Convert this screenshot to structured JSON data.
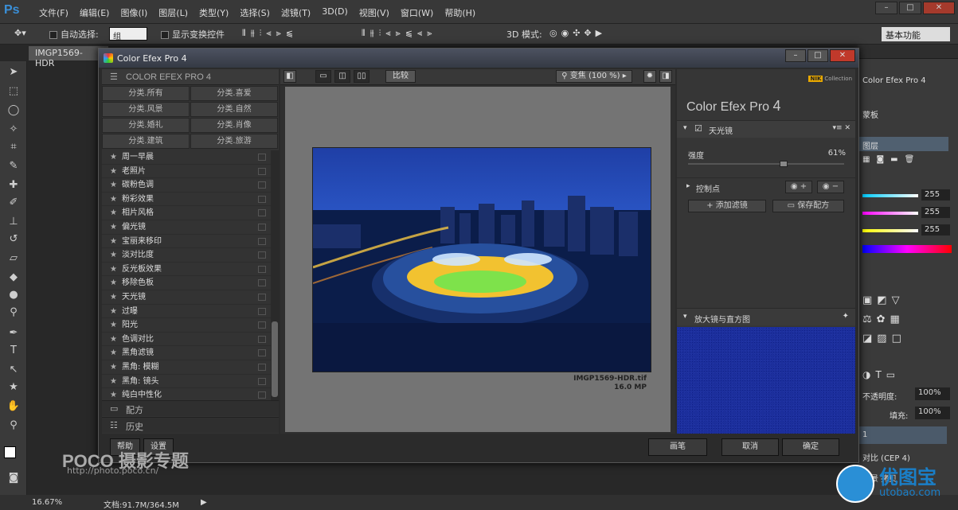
{
  "ps": {
    "logo": "Ps",
    "menus": [
      "文件(F)",
      "编辑(E)",
      "图像(I)",
      "图层(L)",
      "类型(Y)",
      "选择(S)",
      "滤镜(T)",
      "3D(D)",
      "视图(V)",
      "窗口(W)",
      "帮助(H)"
    ],
    "min": "–",
    "max": "□",
    "close": "✕"
  },
  "options": {
    "auto_select": "自动选择:",
    "group": "组",
    "show_transform": "显示变换控件",
    "mode3d": "3D 模式:",
    "workspace": "基本功能"
  },
  "doc_tab": "IMGP1569-HDR",
  "status": {
    "zoom": "16.67%",
    "doc": "文档:91.7M/364.5M"
  },
  "right_panel": {
    "tab": "Color Efex Pro 4",
    "masks": "蒙板",
    "layers": "图层",
    "val1": "255",
    "val2": "255",
    "val3": "255",
    "opacity_label": "不透明度:",
    "opacity": "100%",
    "fill_label": "填充:",
    "fill": "100%",
    "layer1": "1",
    "layer2": "对比 (CEP 4)",
    "layer3": "背景 拷贝"
  },
  "dialog": {
    "title": "Color Efex Pro 4",
    "panel_head": "COLOR EFEX PRO 4",
    "categories": [
      "分类.所有",
      "分类.喜爱",
      "分类.风景",
      "分类.自然",
      "分类.婚礼",
      "分类.肖像",
      "分类.建筑",
      "分类.旅游"
    ],
    "filters": [
      "周一早晨",
      "老照片",
      "碳粉色调",
      "粉彩效果",
      "相片风格",
      "偏光镜",
      "宝丽来移印",
      "淡对比度",
      "反光板效果",
      "移除色板",
      "天光镜",
      "过曝",
      "阳光",
      "色调对比",
      "黑角滤镜",
      "黑角: 模糊",
      "黑角: 镜头",
      "纯白中性化"
    ],
    "recipes": "配方",
    "history": "历史",
    "compare": "比较",
    "zoom": "变焦 (100 %)",
    "file_name": "IMGP1569-HDR.tif",
    "file_size": "16.0 MP",
    "brand_small": "Collection",
    "brand_tag": "NIK",
    "app_title": "Color Efex Pro",
    "app_ver": "4",
    "filter_name": "天光镜",
    "strength_label": "强度",
    "strength_value": "61%",
    "strength_level": 0.61,
    "control_points": "控制点",
    "add_filter": "添加滤镜",
    "save_recipe": "保存配方",
    "loupe": "放大镜与直方图",
    "help": "帮助",
    "settings": "设置",
    "brush": "画笔",
    "cancel": "取消",
    "ok": "确定"
  },
  "watermark": {
    "poco": "POCO 摄影专题",
    "poco_url": "http://photo.poco.cn/",
    "site": "优图宝",
    "site_url": "utobao.com"
  }
}
